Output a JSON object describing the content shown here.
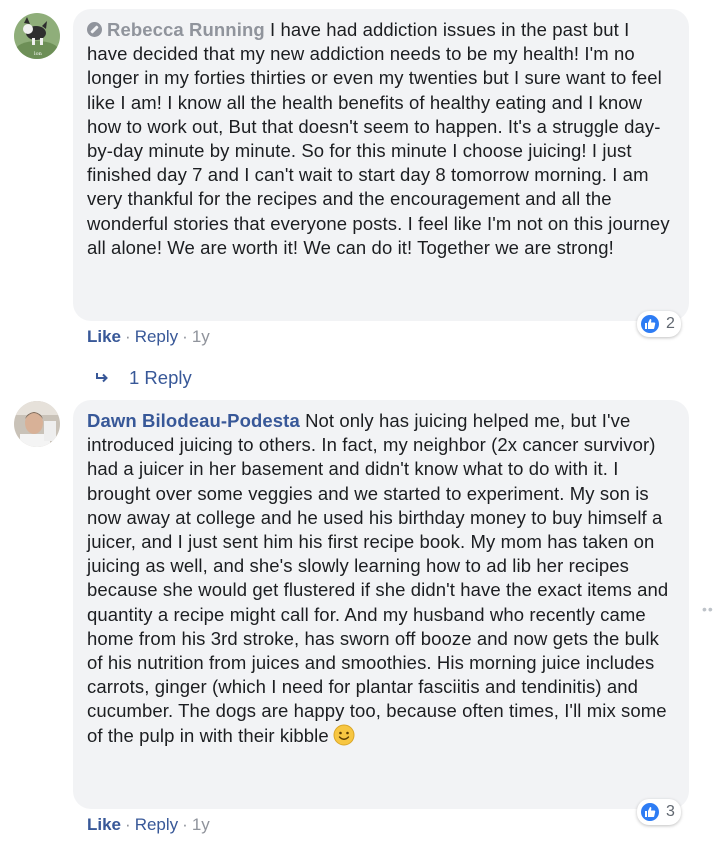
{
  "comments": [
    {
      "author": "Rebecca Running",
      "text": "I have had addiction issues in the past but I have decided that my new addiction needs to be my health! I'm no longer in my forties thirties or even my twenties but I sure want to feel like I am! I know all the health benefits of healthy eating and I know how to work out, But that doesn't seem to happen. It's a struggle day-by-day minute by minute. So for this minute I choose juicing! I just finished day 7 and I can't wait to start day 8 tomorrow morning. I am very thankful for the recipes and the encouragement and all the wonderful stories that everyone posts. I feel like I'm not on this journey all alone! We are worth it! We can do it! Together we are strong!",
      "reaction_count": "2",
      "like_label": "Like",
      "reply_label": "Reply",
      "time": "1y",
      "replies_label": "1 Reply"
    },
    {
      "author": "Dawn Bilodeau-Podesta",
      "text": "Not only has juicing helped me, but I've introduced juicing to others. In fact, my neighbor (2x cancer survivor) had a juicer in her basement and didn't know what to do with it. I brought over some veggies and we started to experiment. My son is now away at college and he used his birthday money to buy himself a juicer, and I just sent him his first recipe book. My mom has taken on juicing as well, and she's slowly learning how to ad lib her recipes because she would get flustered if she didn't have the exact items and quantity a recipe might call for. And my husband who recently came home from his 3rd stroke, has sworn off booze and now gets the bulk of his nutrition from juices and smoothies. His morning juice includes carrots, ginger (which I need for plantar fasciitis and tendinitis) and cucumber. The dogs are happy too, because often times, I'll mix some of the pulp in with their kibble",
      "reaction_count": "3",
      "like_label": "Like",
      "reply_label": "Reply",
      "time": "1y"
    }
  ],
  "colors": {
    "link": "#385898",
    "bubble": "#f2f3f5",
    "meta": "#90949c",
    "like_blue": "#2d7cf4"
  },
  "icons": [
    "avatar-dog",
    "avatar-man",
    "like-thumb-icon",
    "reply-arrow-icon",
    "smiley-emoji",
    "verified-badge-icon",
    "more-dots-icon"
  ]
}
